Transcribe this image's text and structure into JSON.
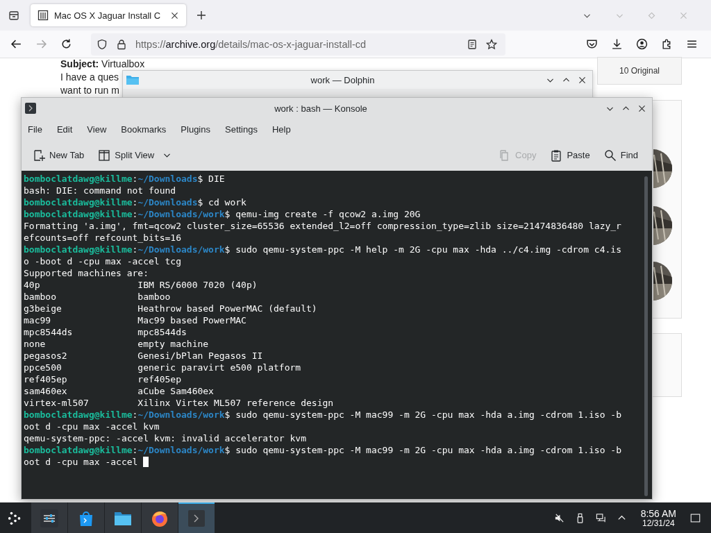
{
  "browser": {
    "tab": {
      "title": "Mac OS X Jaguar Install C",
      "selected": true
    },
    "url": {
      "scheme": "https://",
      "host": "archive.org",
      "path": "/details/mac-os-x-jaguar-install-cd"
    },
    "page": {
      "subject_label": "Subject:",
      "subject": "Virtualbox",
      "body_lines": [
        "I have a ques",
        "want to run m"
      ],
      "button": "10 Original"
    }
  },
  "dolphin": {
    "title": "work — Dolphin"
  },
  "konsole": {
    "title": "work : bash — Konsole",
    "menu": [
      "File",
      "Edit",
      "View",
      "Bookmarks",
      "Plugins",
      "Settings",
      "Help"
    ],
    "toolbar": [
      {
        "kind": "new-tab",
        "label": "New Tab",
        "disabled": false
      },
      {
        "kind": "split-view",
        "label": "Split View",
        "disabled": false
      },
      {
        "kind": "copy",
        "label": "Copy",
        "disabled": true
      },
      {
        "kind": "paste",
        "label": "Paste",
        "disabled": false
      },
      {
        "kind": "find",
        "label": "Find",
        "disabled": false
      }
    ],
    "lines": [
      {
        "user": "bomboclatdawg@killme",
        "sep": ":",
        "path": "~/Downloads",
        "text": "$ DIE"
      },
      {
        "text": "bash: DIE: command not found"
      },
      {
        "user": "bomboclatdawg@killme",
        "sep": ":",
        "path": "~/Downloads",
        "text": "$ cd work"
      },
      {
        "user": "bomboclatdawg@killme",
        "sep": ":",
        "path": "~/Downloads/work",
        "text": "$ qemu-img create -f qcow2 a.img 20G"
      },
      {
        "text": "Formatting 'a.img', fmt=qcow2 cluster_size=65536 extended_l2=off compression_type=zlib size=21474836480 lazy_r"
      },
      {
        "text": "efcounts=off refcount_bits=16"
      },
      {
        "user": "bomboclatdawg@killme",
        "sep": ":",
        "path": "~/Downloads/work",
        "text": "$ sudo qemu-system-ppc -M help -m 2G -cpu max -hda ../c4.img -cdrom c4.is"
      },
      {
        "text": "o -boot d -cpu max -accel tcg"
      },
      {
        "text": "Supported machines are:"
      },
      {
        "text": "40p                  IBM RS/6000 7020 (40p)"
      },
      {
        "text": "bamboo               bamboo"
      },
      {
        "text": "g3beige              Heathrow based PowerMAC (default)"
      },
      {
        "text": "mac99                Mac99 based PowerMAC"
      },
      {
        "text": "mpc8544ds            mpc8544ds"
      },
      {
        "text": "none                 empty machine"
      },
      {
        "text": "pegasos2             Genesi/bPlan Pegasos II"
      },
      {
        "text": "ppce500              generic paravirt e500 platform"
      },
      {
        "text": "ref405ep             ref405ep"
      },
      {
        "text": "sam460ex             aCube Sam460ex"
      },
      {
        "text": "virtex-ml507         Xilinx Virtex ML507 reference design"
      },
      {
        "user": "bomboclatdawg@killme",
        "sep": ":",
        "path": "~/Downloads/work",
        "text": "$ sudo qemu-system-ppc -M mac99 -m 2G -cpu max -hda a.img -cdrom 1.iso -b"
      },
      {
        "text": "oot d -cpu max -accel kvm"
      },
      {
        "text": "qemu-system-ppc: -accel kvm: invalid accelerator kvm"
      },
      {
        "user": "bomboclatdawg@killme",
        "sep": ":",
        "path": "~/Downloads/work",
        "text": "$ sudo qemu-system-ppc -M mac99 -m 2G -cpu max -hda a.img -cdrom 1.iso -b"
      },
      {
        "text": "oot d -cpu max -accel "
      }
    ],
    "cursor_visible": true
  },
  "taskbar": {
    "tasks": [
      {
        "kind": "settings",
        "active": false
      },
      {
        "kind": "store",
        "active": false
      },
      {
        "kind": "files",
        "active": false
      },
      {
        "kind": "firefox",
        "active": false
      },
      {
        "kind": "terminal",
        "active": true
      }
    ],
    "clock": {
      "time": "8:56 AM",
      "date": "12/31/24"
    }
  }
}
